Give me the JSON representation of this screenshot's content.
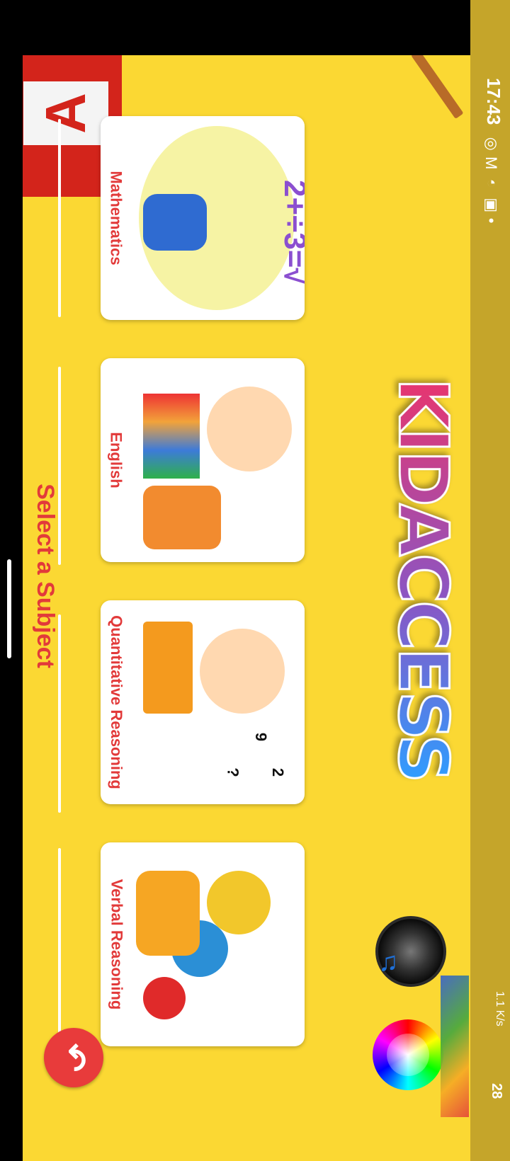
{
  "status_bar": {
    "time": "17:43",
    "network_speed": "1.1 K/s",
    "battery": "28"
  },
  "app": {
    "title": "KIDACCESS",
    "prompt": "Select a Subject"
  },
  "subjects": [
    {
      "label": "Mathematics"
    },
    {
      "label": "English"
    },
    {
      "label": "Quantitative Reasoning"
    },
    {
      "label": "Verbal Reasoning"
    }
  ],
  "icons": {
    "back": "back-arrow-icon",
    "music": "music-speaker-icon",
    "palette": "color-wheel-icon"
  }
}
